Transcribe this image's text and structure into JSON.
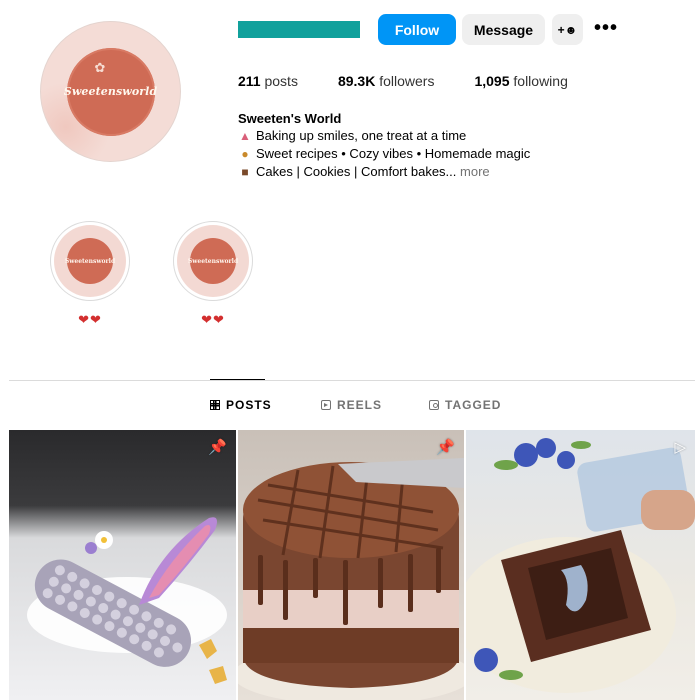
{
  "profile": {
    "avatar_text": "Sweetensworld",
    "buttons": {
      "follow": "Follow",
      "message": "Message"
    },
    "stats": {
      "posts_value": "211",
      "posts_label": "posts",
      "followers_value": "89.3K",
      "followers_label": "followers",
      "following_value": "1,095",
      "following_label": "following"
    },
    "bio": {
      "name": "Sweeten's World",
      "line1": "Baking up smiles, one treat at a time",
      "line2": "Sweet recipes • Cozy vibes • Homemade magic",
      "line3": "Cakes | Cookies | Comfort bakes...",
      "more": "more",
      "icons": [
        "cupcake-emoji",
        "cookie-emoji",
        "cake-slice-emoji"
      ]
    }
  },
  "highlights": [
    {
      "label": "❤❤",
      "thumb_text": "Sweetensworld"
    },
    {
      "label": "❤❤",
      "thumb_text": "Sweetensworld"
    }
  ],
  "tabs": [
    {
      "label": "POSTS",
      "icon": "grid-icon",
      "active": true
    },
    {
      "label": "REELS",
      "icon": "reels-icon",
      "active": false
    },
    {
      "label": "TAGGED",
      "icon": "tagged-icon",
      "active": false
    }
  ],
  "posts": [
    {
      "subject": "purple corn cake with rainbow spoon",
      "badge": "pin-icon"
    },
    {
      "subject": "chocolate drizzle tiramisu cake",
      "badge": "pin-icon"
    },
    {
      "subject": "blue cream poured into brownie box",
      "badge": "reel-icon"
    }
  ],
  "colors": {
    "accent": "#0095f6",
    "username_redaction": "#11a19c",
    "avatar_brand": "#cf6b55"
  }
}
